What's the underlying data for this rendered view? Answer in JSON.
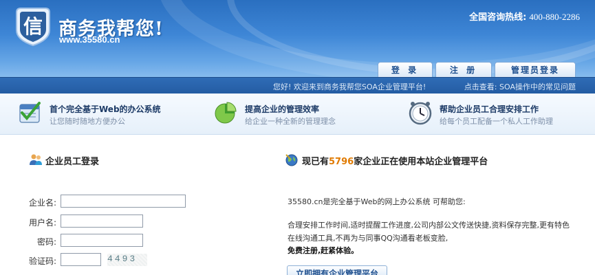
{
  "header": {
    "logo_text": "商务我帮您!",
    "logo_url": "www.35580.cn",
    "logo_char": "信",
    "hotline_label": "全国咨询热线:",
    "hotline_number": "400-880-2286"
  },
  "tabs": [
    {
      "label": "登 录"
    },
    {
      "label": "注 册"
    },
    {
      "label": "管理员登录"
    }
  ],
  "navbar": {
    "welcome": "您好! 欢迎来到商务我帮您SOA企业管理平台!",
    "faq": "点击查看: SOA操作中的常见问题"
  },
  "features": [
    {
      "title": "首个完全基于Web的办公系统",
      "subtitle": "让您随时随地方便办公",
      "icon": "checklist-icon"
    },
    {
      "title": "提高企业的管理效率",
      "subtitle": "给企业一种全新的管理理念",
      "icon": "pie-chart-icon"
    },
    {
      "title": "帮助企业员工合理安排工作",
      "subtitle": "给每个员工配备一个私人工作助理",
      "icon": "clock-icon"
    }
  ],
  "login": {
    "title": "企业员工登录",
    "fields": [
      {
        "label": "企业名:",
        "value": ""
      },
      {
        "label": "用户名:",
        "value": ""
      },
      {
        "label": "密码:",
        "value": ""
      },
      {
        "label": "验证码:",
        "value": ""
      }
    ],
    "captcha": "4493"
  },
  "stats": {
    "title_prefix": "现已有",
    "count": "5796",
    "title_suffix": "家企业正在使用本站企业管理平台",
    "intro": "35580.cn是完全基于Web的网上办公系统 可帮助您:",
    "body": "合理安排工作时间,适时提醒工作进度,公司内部公文传送快捷,资料保存完整,更有特色在线沟通工具,不再为与同事QQ沟通看老板变脸,",
    "cta": "免费注册,赶紧体验。",
    "button": "立即拥有企业管理平台"
  },
  "colors": {
    "header_blue": "#3e86d6",
    "nav_blue": "#2f6cb6",
    "accent_orange": "#e07a00"
  }
}
